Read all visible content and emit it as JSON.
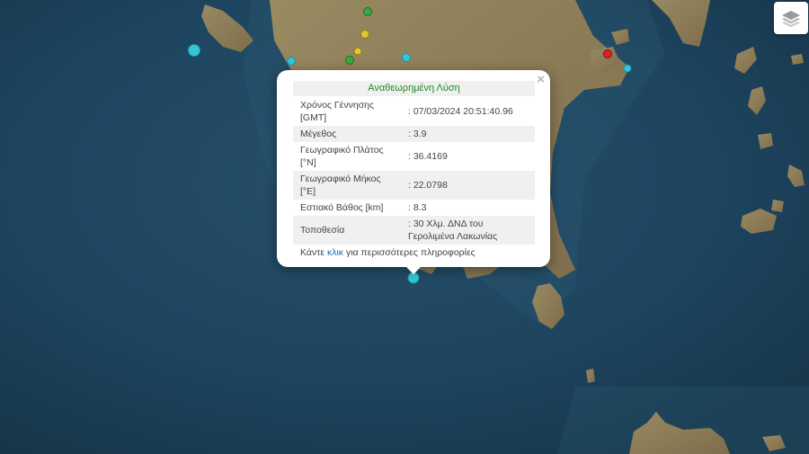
{
  "colors": {
    "sea": "#1c3f55",
    "land": "#8a7a58",
    "quake_cyan": "#35c6d6",
    "quake_green": "#3aa843",
    "quake_yellow": "#e2c531",
    "quake_red": "#e02020",
    "title_green": "#1e8a1e",
    "link_blue": "#1a6fb3"
  },
  "icons": {
    "layers": "layers-icon",
    "close": "close-icon"
  },
  "popup": {
    "close_label": "×",
    "title": "Αναθεωρημένη Λύση",
    "rows": [
      {
        "key": "Χρόνος Γέννησης [GMT]",
        "value": ": 07/03/2024 20:51:40.96"
      },
      {
        "key": "Μέγεθος",
        "value": ": 3.9"
      },
      {
        "key": "Γεωγραφικό Πλάτος [°N]",
        "value": ": 36.4169"
      },
      {
        "key": "Γεωγραφικό Μήκος [°E]",
        "value": ": 22.0798"
      },
      {
        "key": "Εστιακό Βάθος [km]",
        "value": ": 8.3"
      },
      {
        "key": "Τοποθεσία",
        "value": ": 30 Χλμ. ΔΝΔ του Γερολιμένα Λακωνίας"
      }
    ],
    "more_prefix": "Κάντε ",
    "more_link": "κλικ",
    "more_suffix": " για περισσότερες πληροφορίες"
  }
}
